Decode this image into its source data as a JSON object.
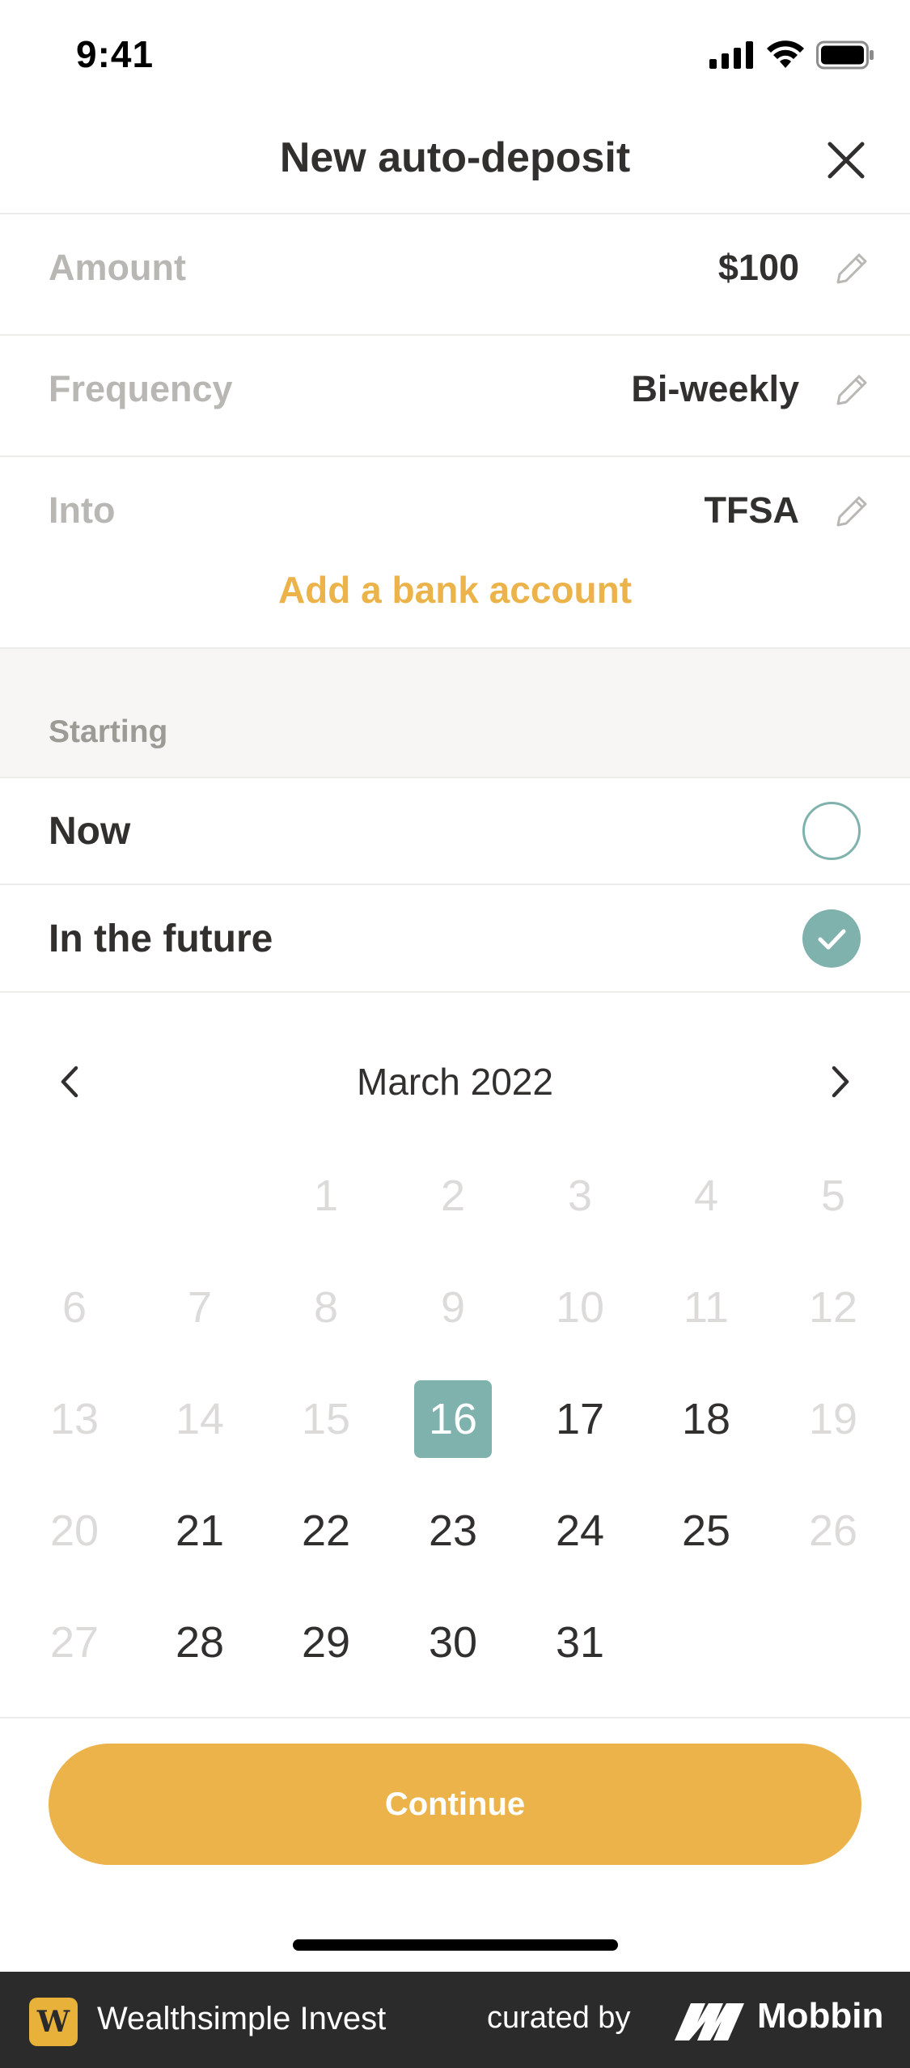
{
  "status_bar": {
    "time": "9:41"
  },
  "header": {
    "title": "New auto-deposit"
  },
  "fields": [
    {
      "label": "Amount",
      "value": "$100"
    },
    {
      "label": "Frequency",
      "value": "Bi-weekly"
    },
    {
      "label": "Into",
      "value": "TFSA"
    }
  ],
  "add_bank": "Add a bank account",
  "starting": {
    "heading": "Starting",
    "options": [
      {
        "label": "Now",
        "selected": false
      },
      {
        "label": "In the future",
        "selected": true
      }
    ]
  },
  "calendar": {
    "month": "March 2022",
    "selected_day": "16",
    "weeks": [
      [
        "",
        "",
        "1",
        "2",
        "3",
        "4",
        "5"
      ],
      [
        "6",
        "7",
        "8",
        "9",
        "10",
        "11",
        "12"
      ],
      [
        "13",
        "14",
        "15",
        "16",
        "17",
        "18",
        "19"
      ],
      [
        "20",
        "21",
        "22",
        "23",
        "24",
        "25",
        "26"
      ],
      [
        "27",
        "28",
        "29",
        "30",
        "31",
        "",
        ""
      ]
    ]
  },
  "continue_label": "Continue",
  "footer": {
    "app_logo_letter": "W",
    "app_name": "Wealthsimple Invest",
    "curated_by": "curated by",
    "brand": "Mobbin"
  },
  "colors": {
    "accent": "#ebb34a",
    "teal": "#7fb1ad",
    "text": "#32302f",
    "muted": "#b8b7b4"
  }
}
